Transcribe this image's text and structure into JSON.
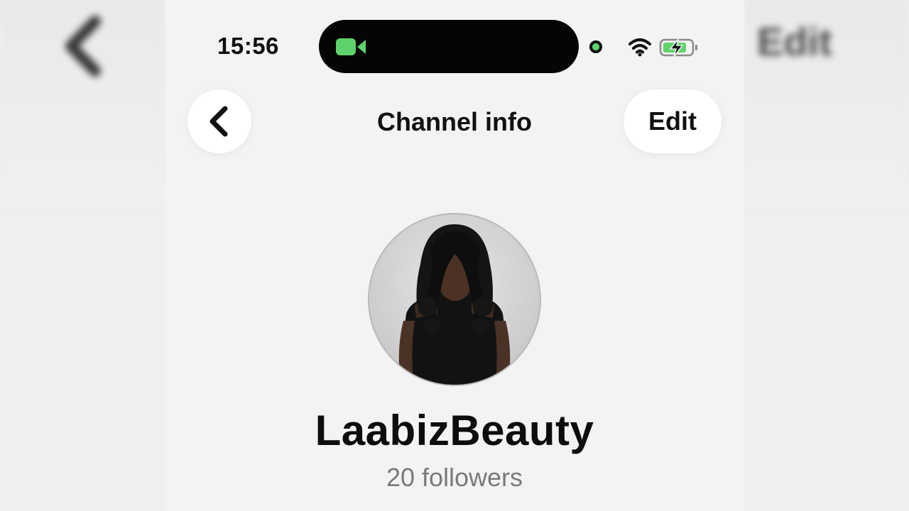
{
  "status_bar": {
    "time": "15:56",
    "facetime_icon": "facetime-video-icon",
    "indicator_color": "#5ed36b",
    "wifi_icon": "wifi-icon",
    "battery_icon": "battery-charging-icon"
  },
  "nav": {
    "back_icon": "chevron-left-icon",
    "title": "Channel info",
    "edit_label": "Edit"
  },
  "background_ghost": {
    "edit_label": "Edit"
  },
  "channel": {
    "avatar": "channel-avatar-photo",
    "name": "LaabizBeauty",
    "followers": "20 followers"
  },
  "colors": {
    "screen_bg": "#f3f3f3",
    "accent_green": "#5ed36b",
    "text_primary": "#111111",
    "text_secondary": "#7a7a7a"
  }
}
